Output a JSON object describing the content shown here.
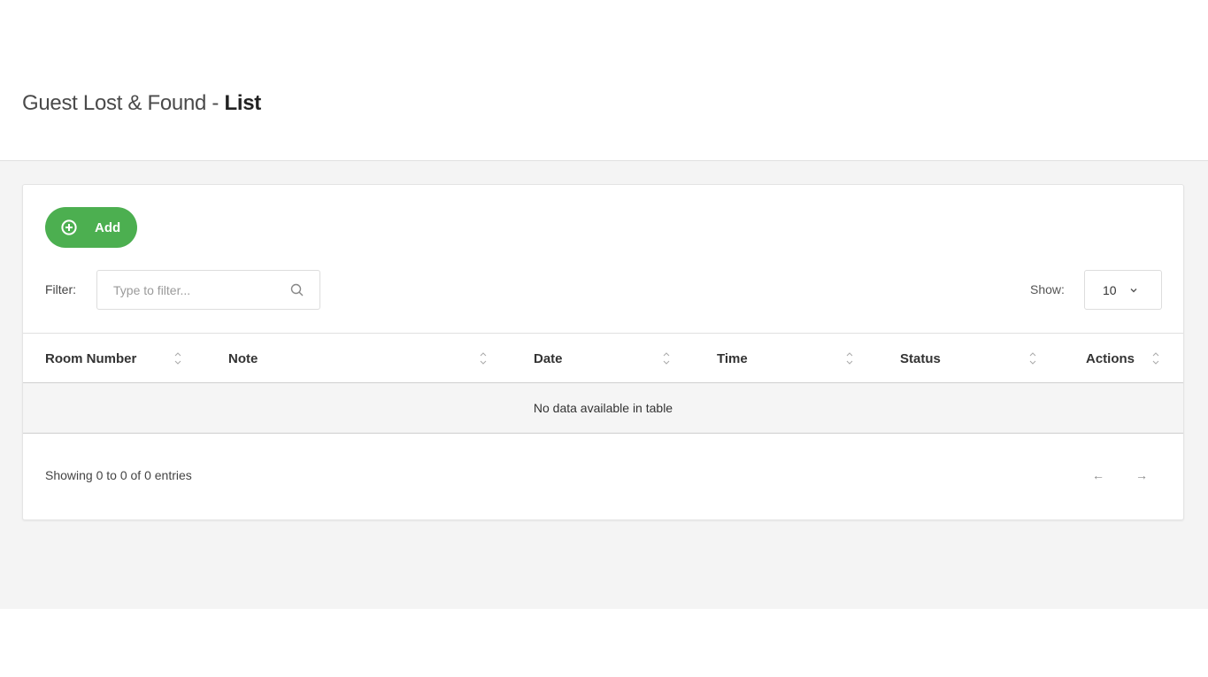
{
  "header": {
    "title_prefix": "Guest Lost & Found - ",
    "title_strong": "List"
  },
  "toolbar": {
    "add_label": "Add",
    "add_icon": "plus-circle-icon",
    "add_color": "#4caf50"
  },
  "filter": {
    "label": "Filter:",
    "value": "",
    "placeholder": "Type to filter...",
    "icon": "search-icon"
  },
  "page_size": {
    "label": "Show:",
    "selected": "10",
    "icon": "chevron-down-icon"
  },
  "table": {
    "columns": [
      {
        "label": "Room Number",
        "sort_icon": "sort-icon"
      },
      {
        "label": "Note",
        "sort_icon": "sort-icon"
      },
      {
        "label": "Date",
        "sort_icon": "sort-icon"
      },
      {
        "label": "Time",
        "sort_icon": "sort-icon"
      },
      {
        "label": "Status",
        "sort_icon": "sort-icon"
      },
      {
        "label": "Actions",
        "sort_icon": "sort-icon"
      }
    ],
    "rows": [],
    "empty_message": "No data available in table"
  },
  "footer": {
    "info": "Showing 0 to 0 of 0 entries",
    "prev_label": "←",
    "next_label": "→"
  }
}
